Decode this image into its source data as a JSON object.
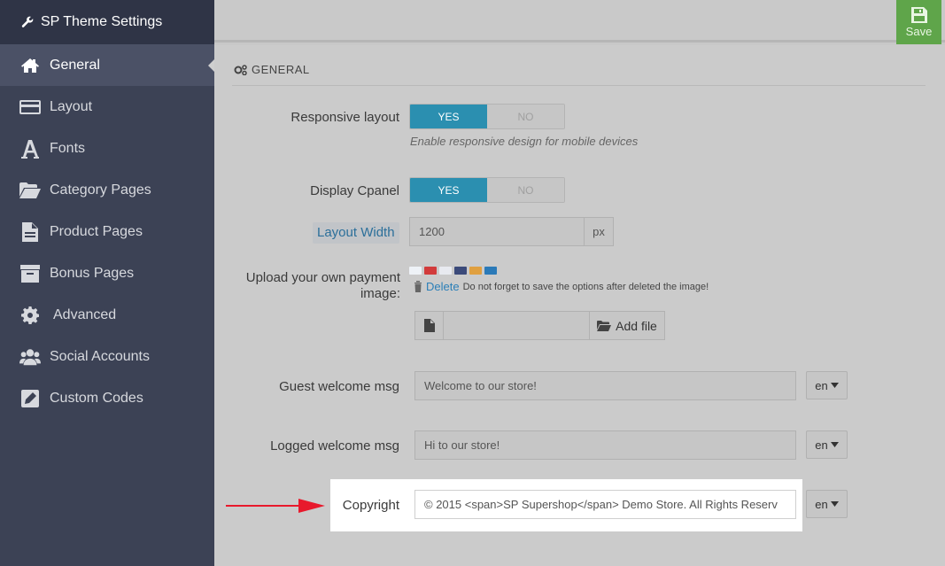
{
  "sidebar": {
    "title": "SP Theme Settings",
    "items": [
      {
        "label": "General",
        "icon": "home-icon"
      },
      {
        "label": "Layout",
        "icon": "card-icon"
      },
      {
        "label": "Fonts",
        "icon": "font-icon"
      },
      {
        "label": "Category Pages",
        "icon": "folder-open-icon"
      },
      {
        "label": "Product Pages",
        "icon": "file-icon"
      },
      {
        "label": "Bonus Pages",
        "icon": "archive-icon"
      },
      {
        "label": "Advanced",
        "icon": "gear-icon"
      },
      {
        "label": "Social Accounts",
        "icon": "users-icon"
      },
      {
        "label": "Custom Codes",
        "icon": "edit-icon"
      }
    ]
  },
  "toolbar": {
    "save_label": "Save"
  },
  "section": {
    "title": "GENERAL"
  },
  "form": {
    "responsive": {
      "label": "Responsive layout",
      "yes": "YES",
      "no": "NO",
      "help": "Enable responsive design for mobile devices"
    },
    "cpanel": {
      "label": "Display Cpanel",
      "yes": "YES",
      "no": "NO"
    },
    "layout_width": {
      "label": "Layout Width",
      "value": "1200",
      "unit": "px"
    },
    "payment": {
      "label_line1": "Upload your own payment",
      "label_line2": "image:",
      "delete_label": "Delete",
      "delete_note": "Do not forget to save the options after deleted the image!",
      "add_file_label": "Add file"
    },
    "guest_msg": {
      "label": "Guest welcome msg",
      "value": "Welcome to our store!",
      "lang": "en"
    },
    "logged_msg": {
      "label": "Logged welcome msg",
      "value": "Hi to our store!",
      "lang": "en"
    },
    "copyright": {
      "label": "Copyright",
      "value": "© 2015 <span>SP Supershop</span> Demo Store. All Rights Reserv",
      "lang": "en"
    }
  },
  "colors": {
    "accent": "#2b8fb0",
    "save": "#5fa54a",
    "sidebar": "#3c4255",
    "arrow": "#e8192c"
  }
}
